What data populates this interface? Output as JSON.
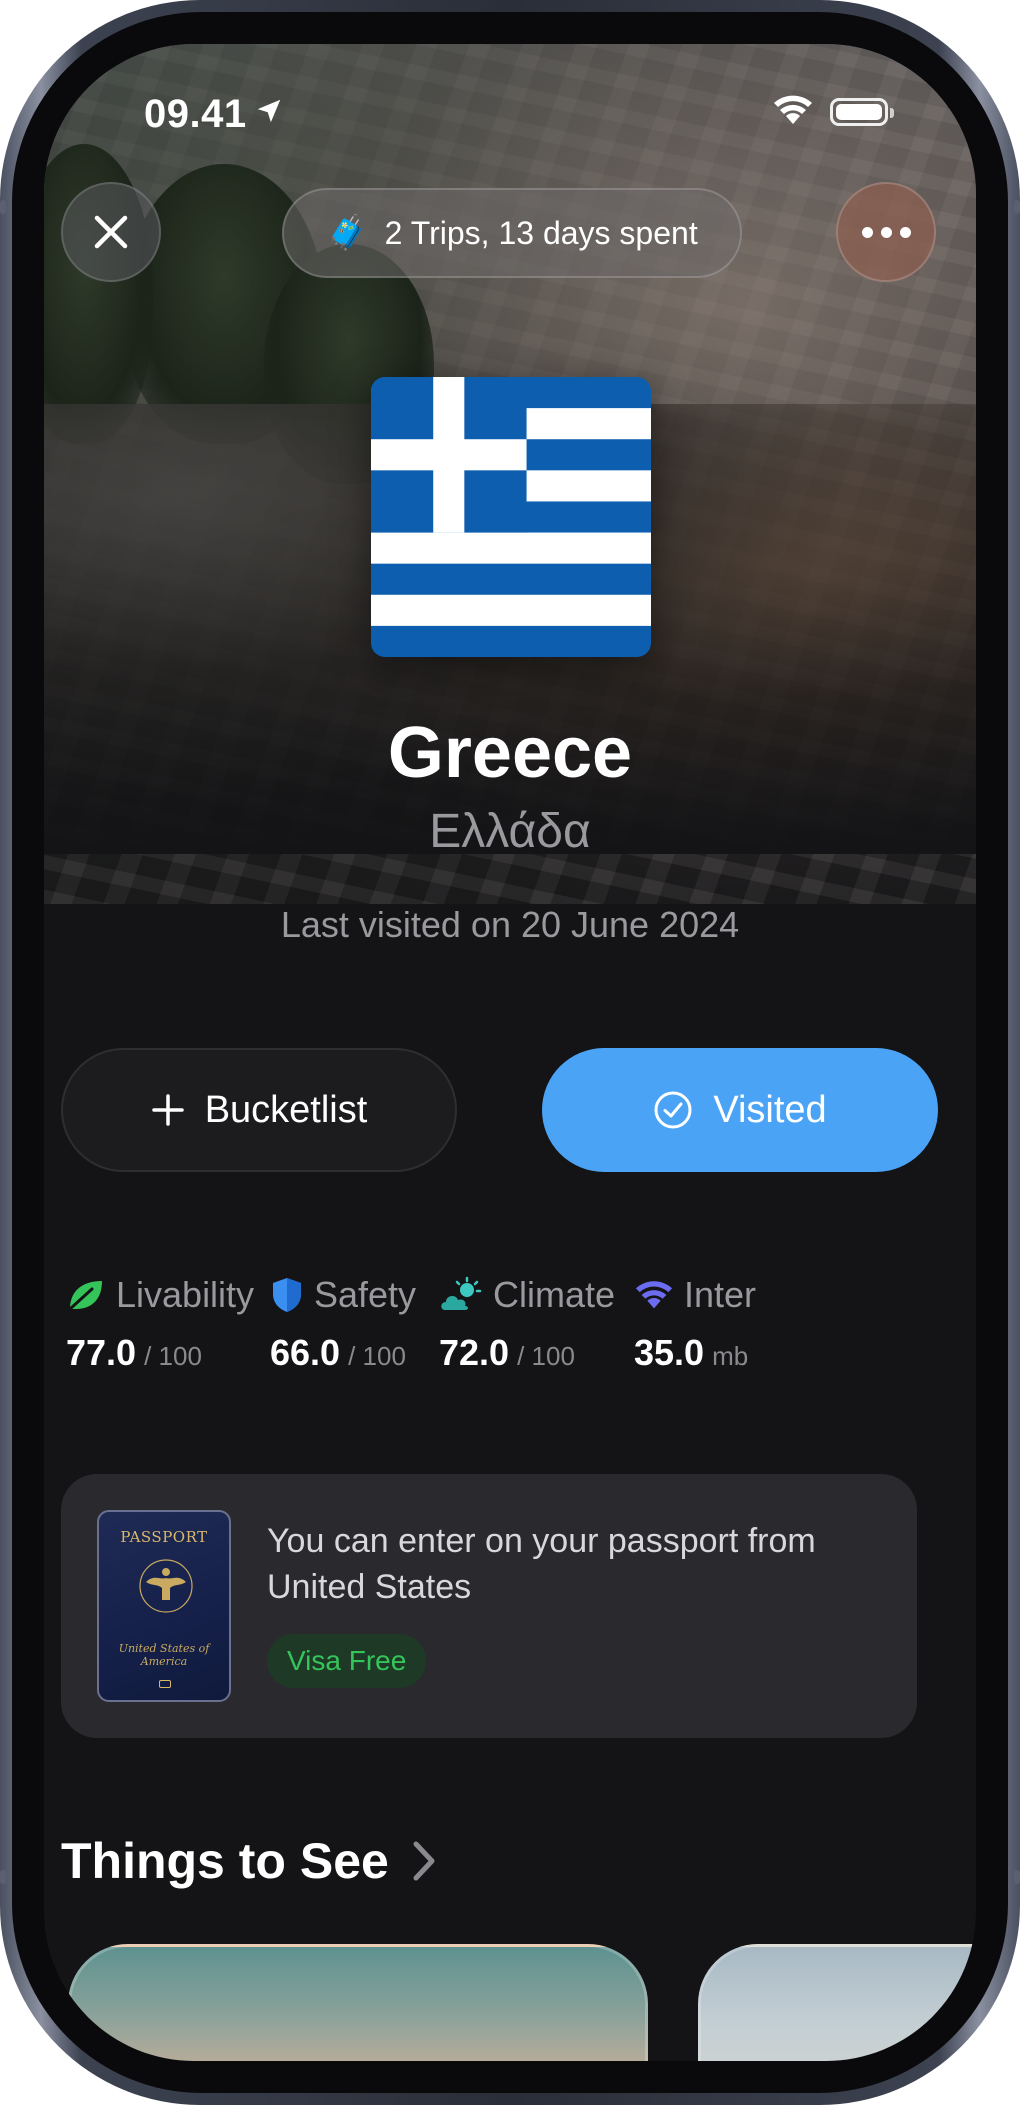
{
  "status_bar": {
    "time": "09.41"
  },
  "header": {
    "trips_icon": "suitcase-emoji",
    "trips_summary": "2 Trips, 13 days spent"
  },
  "country": {
    "flag": "greece-flag",
    "name": "Greece",
    "native_name": "Ελλάδα",
    "last_visited": "Last visited on 20 June 2024"
  },
  "actions": {
    "bucketlist_label": "Bucketlist",
    "visited_label": "Visited",
    "visited_color": "#4aa3f4"
  },
  "stats": [
    {
      "icon": "leaf-icon",
      "label": "Livability",
      "value": "77.0",
      "unit": "/ 100",
      "color": "#35c45a"
    },
    {
      "icon": "shield-icon",
      "label": "Safety",
      "value": "66.0",
      "unit": "/ 100",
      "color": "#3b8ff0"
    },
    {
      "icon": "weather-icon",
      "label": "Climate",
      "value": "72.0",
      "unit": "/ 100",
      "color": "#3cc8c0"
    },
    {
      "icon": "wifi-icon",
      "label": "Inter",
      "value": "35.0",
      "unit": "mb",
      "color": "#6c6cf0"
    }
  ],
  "passport": {
    "cover_title": "PASSPORT",
    "cover_country": "United States of America",
    "message": "You can enter on your passport from United States",
    "visa_status": "Visa Free",
    "visa_color": "#35c45a"
  },
  "things_to_see": {
    "title": "Things to See"
  }
}
